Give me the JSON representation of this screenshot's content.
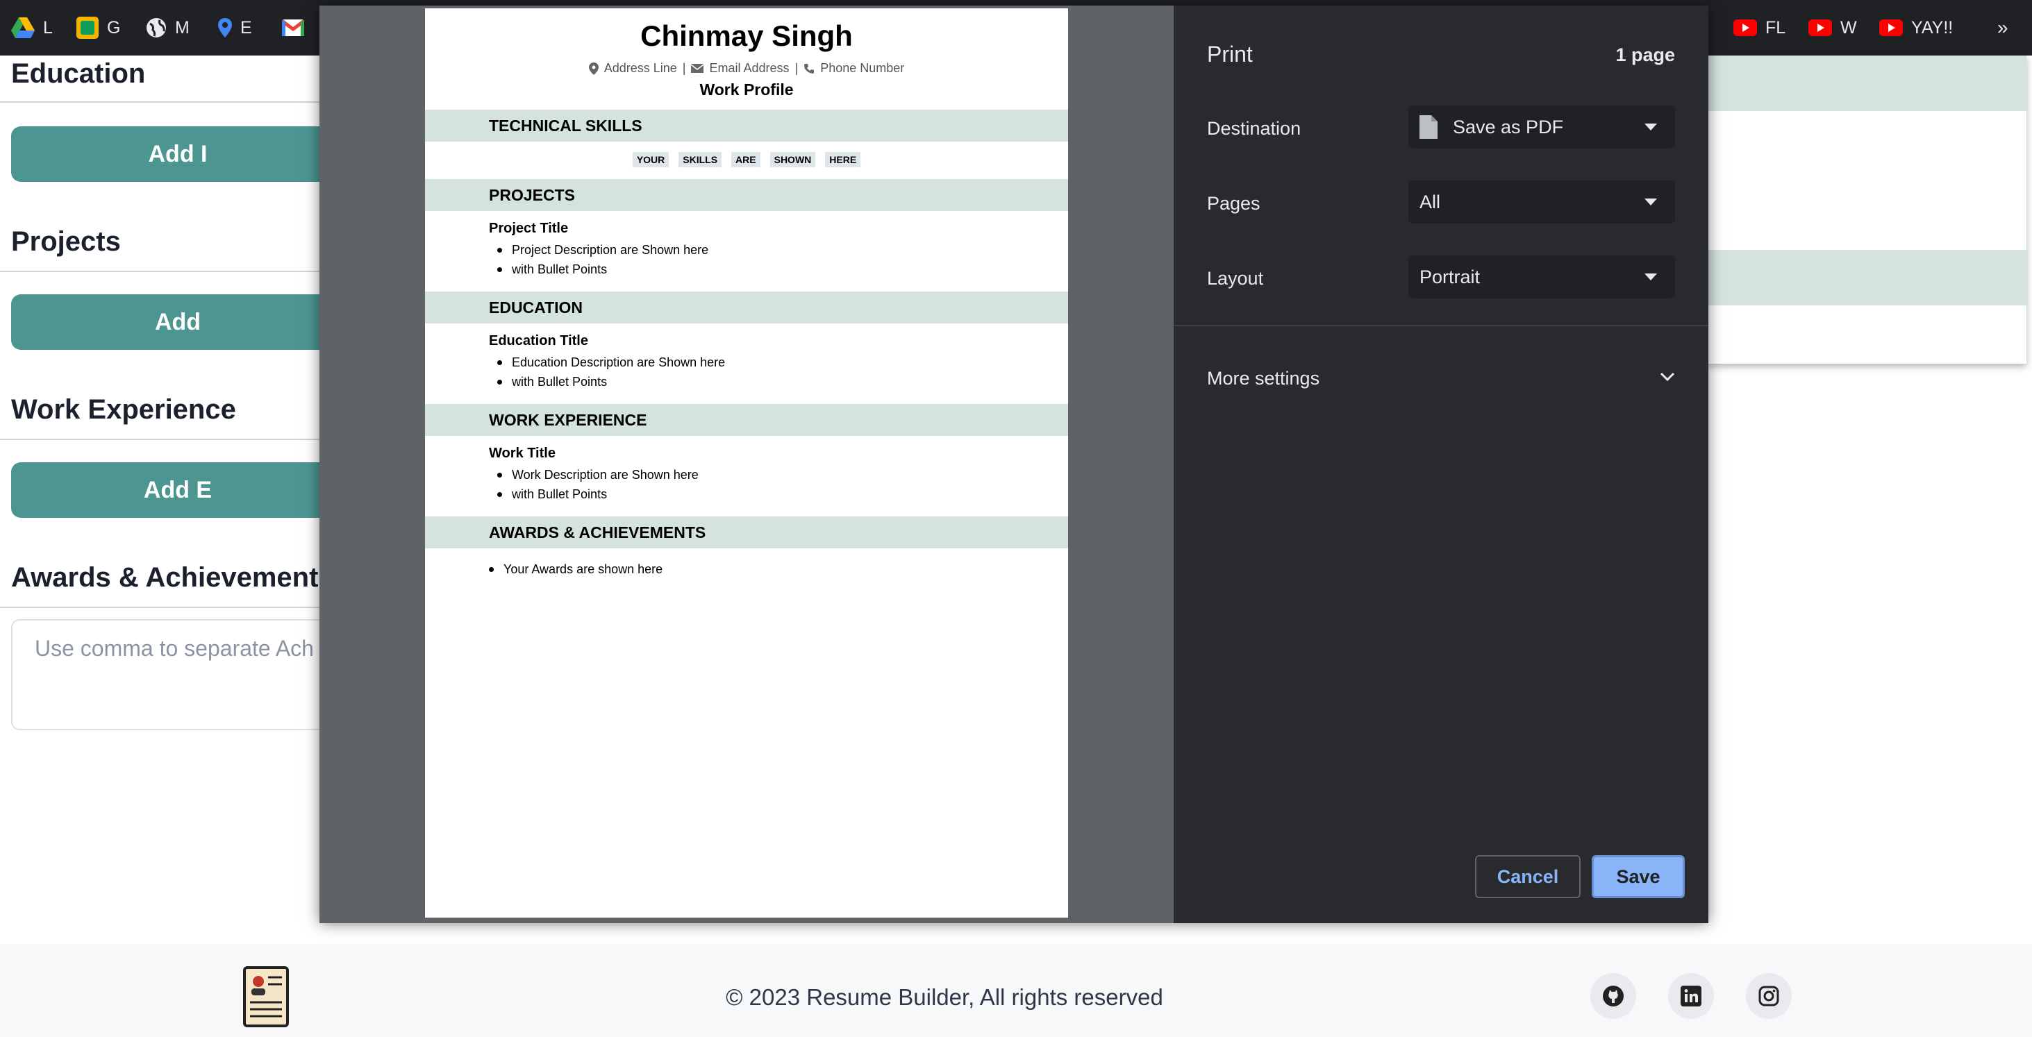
{
  "bookmarks": [
    {
      "label": "L",
      "icon": "google-drive-icon"
    },
    {
      "label": "G",
      "icon": "google-classroom-icon"
    },
    {
      "label": "M",
      "icon": "globe-icon"
    },
    {
      "label": "E",
      "icon": "maps-pin-icon"
    },
    {
      "label": "",
      "icon": "gmail-icon"
    },
    {
      "label": "FL",
      "icon": "youtube-icon"
    },
    {
      "label": "W",
      "icon": "youtube-icon"
    },
    {
      "label": "YAY!!",
      "icon": "youtube-icon"
    }
  ],
  "bookmarks_more": "»",
  "form": {
    "education_heading": "Education",
    "education_button": "Add I",
    "projects_heading": "Projects",
    "projects_button": "Add",
    "work_heading": "Work Experience",
    "work_button": "Add E",
    "awards_heading": "Awards & Achievement",
    "awards_placeholder": "Use comma to separate Ach"
  },
  "preview": {
    "name": "Chinmay Singh",
    "address": "Address Line",
    "email": "Email Address",
    "phone": "Phone Number",
    "separator": "|",
    "profile": "Work Profile",
    "skills_heading": "TECHNICAL SKILLS",
    "skills": [
      "YOUR",
      "SKILLS",
      "ARE",
      "SHOWN",
      "HERE"
    ],
    "projects_heading": "PROJECTS",
    "project_title": "Project Title",
    "project_bullets": [
      "Project Description are Shown here",
      "with Bullet Points"
    ],
    "education_heading": "EDUCATION",
    "education_title": "Education Title",
    "education_bullets": [
      "Education Description are Shown here",
      "with Bullet Points"
    ],
    "work_heading": "WORK EXPERIENCE",
    "work_title": "Work Title",
    "work_bullets": [
      "Work Description are Shown here",
      "with Bullet Points"
    ],
    "awards_heading": "AWARDS & ACHIEVEMENTS",
    "award_bullet": "Your Awards are shown here"
  },
  "print": {
    "title": "Print",
    "page_count": "1 page",
    "destination_label": "Destination",
    "destination_value": "Save as PDF",
    "pages_label": "Pages",
    "pages_value": "All",
    "layout_label": "Layout",
    "layout_value": "Portrait",
    "more_settings": "More settings",
    "cancel": "Cancel",
    "save": "Save"
  },
  "footer": {
    "copyright": "© 2023 Resume Builder, All rights reserved",
    "social": [
      "github-icon",
      "linkedin-icon",
      "instagram-icon"
    ]
  }
}
